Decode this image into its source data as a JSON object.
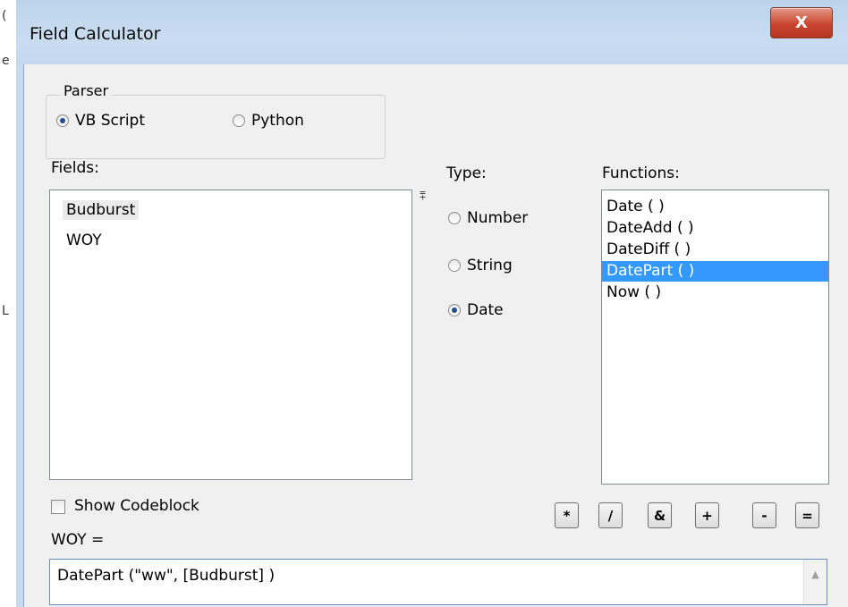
{
  "window": {
    "title": "Field Calculator",
    "close_label": "X"
  },
  "parser": {
    "group_label": "Parser",
    "options": [
      {
        "label": "VB Script",
        "checked": true
      },
      {
        "label": "Python",
        "checked": false
      }
    ]
  },
  "fields": {
    "label": "Fields:",
    "items": [
      "Budburst",
      "WOY"
    ],
    "sort_glyph": "⩱"
  },
  "type": {
    "label": "Type:",
    "options": [
      {
        "label": "Number",
        "checked": false
      },
      {
        "label": "String",
        "checked": false
      },
      {
        "label": "Date",
        "checked": true
      }
    ]
  },
  "functions": {
    "label": "Functions:",
    "items": [
      "Date ( )",
      "DateAdd ( )",
      "DateDiff ( )",
      "DatePart ( )",
      "Now ( )"
    ],
    "selected": "DatePart ( )"
  },
  "codeblock": {
    "label": "Show Codeblock",
    "checked": false
  },
  "operators": [
    "*",
    "/",
    "&",
    "+",
    "-",
    "="
  ],
  "expression": {
    "target_label": "WOY =",
    "value": "DatePart (\"ww\", [Budburst] )"
  },
  "colors": {
    "selection": "#3399ff",
    "close_button": "#c9462f",
    "title_bar": "#c6d9ee"
  },
  "icons": {
    "scroll_up": "chevron-up-icon"
  }
}
